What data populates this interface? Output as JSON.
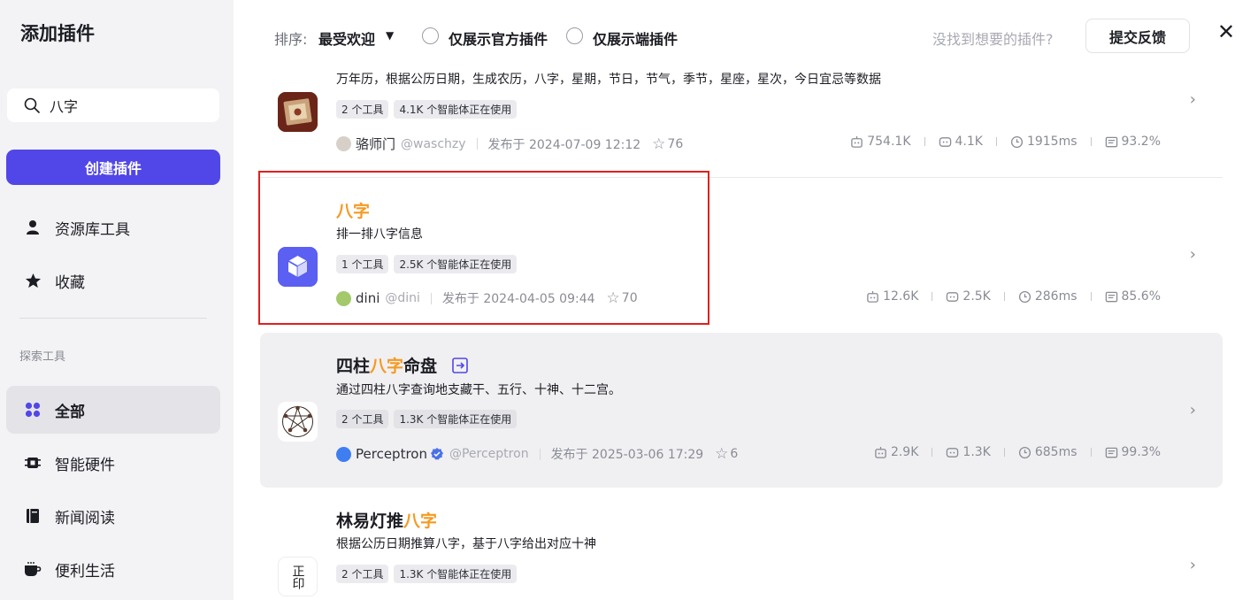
{
  "sidebar": {
    "title": "添加插件",
    "search_value": "八字",
    "create_label": "创建插件",
    "nav": [
      {
        "label": "资源库工具",
        "icon": "user-icon"
      },
      {
        "label": "收藏",
        "icon": "star-icon"
      }
    ],
    "section_label": "探索工具",
    "categories": [
      {
        "label": "全部",
        "icon": "grid-icon",
        "active": true
      },
      {
        "label": "智能硬件",
        "icon": "chip-icon"
      },
      {
        "label": "新闻阅读",
        "icon": "book-icon"
      },
      {
        "label": "便利生活",
        "icon": "cup-icon"
      }
    ]
  },
  "header": {
    "sort_label": "排序:",
    "sort_value": "最受欢迎",
    "filter_official": "仅展示官方插件",
    "filter_endpoint": "仅展示端插件",
    "hint": "没找到想要的插件?",
    "feedback_label": "提交反馈"
  },
  "plugins": [
    {
      "desc": "万年历，根据公历日期，生成农历，八字，星期，节日，节气，季节，星座，星次，今日宜忌等数据",
      "tags": [
        "2 个工具",
        "4.1K 个智能体正在使用"
      ],
      "author": "骆师门",
      "handle": "@waschzy",
      "published": "发布于 2024-07-09 12:12",
      "stars": "76",
      "stats": [
        "754.1K",
        "4.1K",
        "1915ms",
        "93.2%"
      ]
    },
    {
      "title_hl": "八字",
      "desc": "排一排八字信息",
      "tags": [
        "1 个工具",
        "2.5K 个智能体正在使用"
      ],
      "author": "dini",
      "handle": "@dini",
      "published": "发布于 2024-04-05 09:44",
      "stars": "70",
      "stats": [
        "12.6K",
        "2.5K",
        "286ms",
        "85.6%"
      ]
    },
    {
      "title_pre": "四柱",
      "title_hl": "八字",
      "title_post": "命盘",
      "desc": "通过四柱八字查询地支藏干、五行、十神、十二宫。",
      "tags": [
        "2 个工具",
        "1.3K 个智能体正在使用"
      ],
      "author": "Perceptron",
      "handle": "@Perceptron",
      "published": "发布于 2025-03-06 17:29",
      "stars": "6",
      "stats": [
        "2.9K",
        "1.3K",
        "685ms",
        "99.3%"
      ]
    },
    {
      "title_pre": "林易灯推",
      "title_hl": "八字",
      "desc": "根据公历日期推算八字，基于八字给出对应十神",
      "tags": [
        "2 个工具",
        "1.3K 个智能体正在使用"
      ],
      "thumb_text": "正印"
    }
  ],
  "colors": {
    "accent": "#5147e8",
    "highlight": "#f59a23",
    "annotation": "#e02020"
  }
}
